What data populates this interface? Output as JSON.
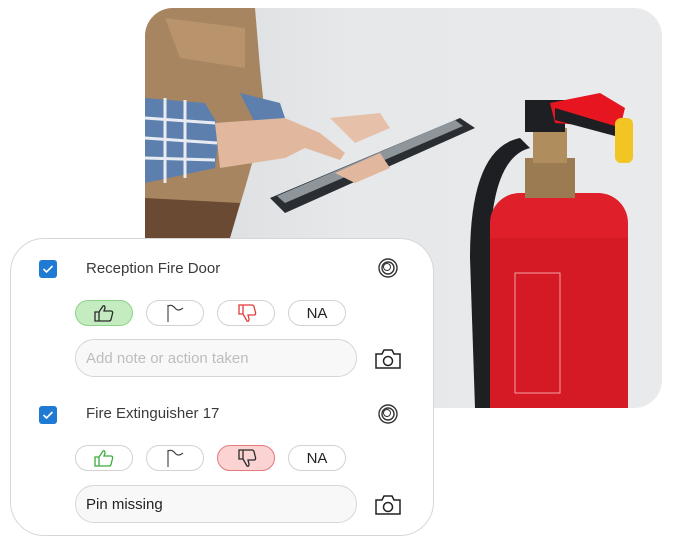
{
  "photo": {
    "description": "technician using tablet next to red fire extinguisher"
  },
  "checklist": {
    "items": [
      {
        "checked": true,
        "title": "Reception Fire Door",
        "responses": {
          "pass": "thumbs-up-icon",
          "flag": "flag-icon",
          "fail": "thumbs-down-icon",
          "na": "NA"
        },
        "selected": "pass",
        "note_placeholder": "Add note or action taken",
        "note_value": ""
      },
      {
        "checked": true,
        "title": "Fire Extinguisher 17",
        "responses": {
          "pass": "thumbs-up-icon",
          "flag": "flag-icon",
          "fail": "thumbs-down-icon",
          "na": "NA"
        },
        "selected": "fail",
        "note_placeholder": "Add note or action taken",
        "note_value": "Pin missing"
      }
    ]
  },
  "colors": {
    "check": "#1f7ad4",
    "pass_bg": "#c4ecc0",
    "fail_bg": "#fbd3d3",
    "pass_icon": "#3cab3c",
    "fail_icon": "#e23b3b"
  }
}
